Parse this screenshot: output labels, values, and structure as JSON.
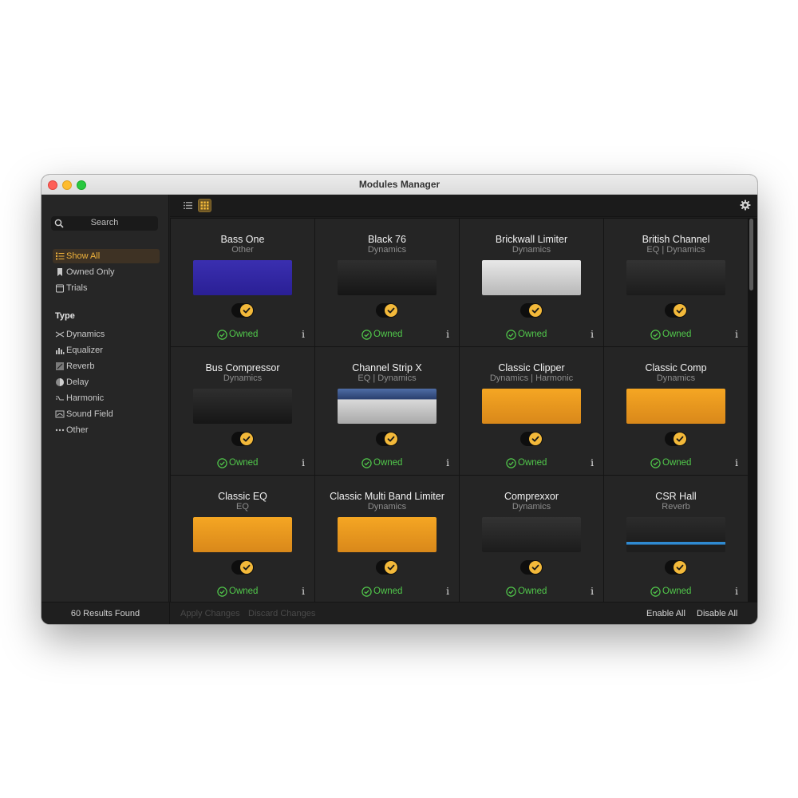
{
  "window": {
    "title": "Modules Manager"
  },
  "sidebar": {
    "search_placeholder": "Search",
    "filters": [
      {
        "label": "Show All",
        "icon": "list-icon",
        "active": true
      },
      {
        "label": "Owned Only",
        "icon": "bookmark-icon",
        "active": false
      },
      {
        "label": "Trials",
        "icon": "calendar-icon",
        "active": false
      }
    ],
    "type_title": "Type",
    "types": [
      {
        "label": "Dynamics",
        "icon": "dynamics-icon"
      },
      {
        "label": "Equalizer",
        "icon": "equalizer-icon"
      },
      {
        "label": "Reverb",
        "icon": "reverb-icon"
      },
      {
        "label": "Delay",
        "icon": "delay-icon"
      },
      {
        "label": "Harmonic",
        "icon": "harmonic-icon"
      },
      {
        "label": "Sound Field",
        "icon": "sound-field-icon"
      },
      {
        "label": "Other",
        "icon": "more-icon"
      }
    ],
    "results": "60 Results Found"
  },
  "toolbar": {
    "list_view_icon": "list-view-icon",
    "grid_view_icon": "grid-view-icon",
    "settings_icon": "gear-icon"
  },
  "modules": [
    {
      "name": "Bass One",
      "category": "Other",
      "status": "Owned",
      "enabled": true,
      "style": "purple"
    },
    {
      "name": "Black 76",
      "category": "Dynamics",
      "status": "Owned",
      "enabled": true,
      "style": "black"
    },
    {
      "name": "Brickwall Limiter",
      "category": "Dynamics",
      "status": "Owned",
      "enabled": true,
      "style": "silver"
    },
    {
      "name": "British Channel",
      "category": "EQ | Dynamics",
      "status": "Owned",
      "enabled": true,
      "style": "dark"
    },
    {
      "name": "Bus Compressor",
      "category": "Dynamics",
      "status": "Owned",
      "enabled": true,
      "style": "black"
    },
    {
      "name": "Channel Strip X",
      "category": "EQ | Dynamics",
      "status": "Owned",
      "enabled": true,
      "style": "silver-blue"
    },
    {
      "name": "Classic Clipper",
      "category": "Dynamics | Harmonic",
      "status": "Owned",
      "enabled": true,
      "style": "orange"
    },
    {
      "name": "Classic Comp",
      "category": "Dynamics",
      "status": "Owned",
      "enabled": true,
      "style": "orange"
    },
    {
      "name": "Classic EQ",
      "category": "EQ",
      "status": "Owned",
      "enabled": true,
      "style": "orange"
    },
    {
      "name": "Classic Multi Band Limiter",
      "category": "Dynamics",
      "status": "Owned",
      "enabled": true,
      "style": "orange"
    },
    {
      "name": "Comprexxor",
      "category": "Dynamics",
      "status": "Owned",
      "enabled": true,
      "style": "dark"
    },
    {
      "name": "CSR Hall",
      "category": "Reverb",
      "status": "Owned",
      "enabled": true,
      "style": "dark-blue"
    }
  ],
  "info_label": "i",
  "footer": {
    "apply": "Apply Changes",
    "discard": "Discard Changes",
    "enable_all": "Enable All",
    "disable_all": "Disable All"
  },
  "colors": {
    "accent": "#f3b93a",
    "owned": "#51c84b",
    "background": "#1e1e1e"
  }
}
